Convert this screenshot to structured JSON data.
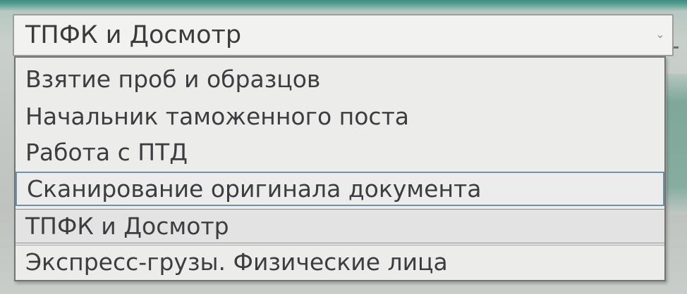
{
  "combobox": {
    "selected_value": "ТПФК и Досмотр",
    "arrow_icon": "chevron-down-icon"
  },
  "dropdown": {
    "options": [
      {
        "label": "Взятие проб и образцов"
      },
      {
        "label": "Начальник таможенного поста"
      },
      {
        "label": "Работа с ПТД"
      },
      {
        "label": "Сканирование оригинала документа",
        "state": "hovered"
      },
      {
        "label": "ТПФК и Досмотр",
        "state": "selected"
      },
      {
        "label": "Экспресс-грузы. Физические лица"
      }
    ]
  }
}
